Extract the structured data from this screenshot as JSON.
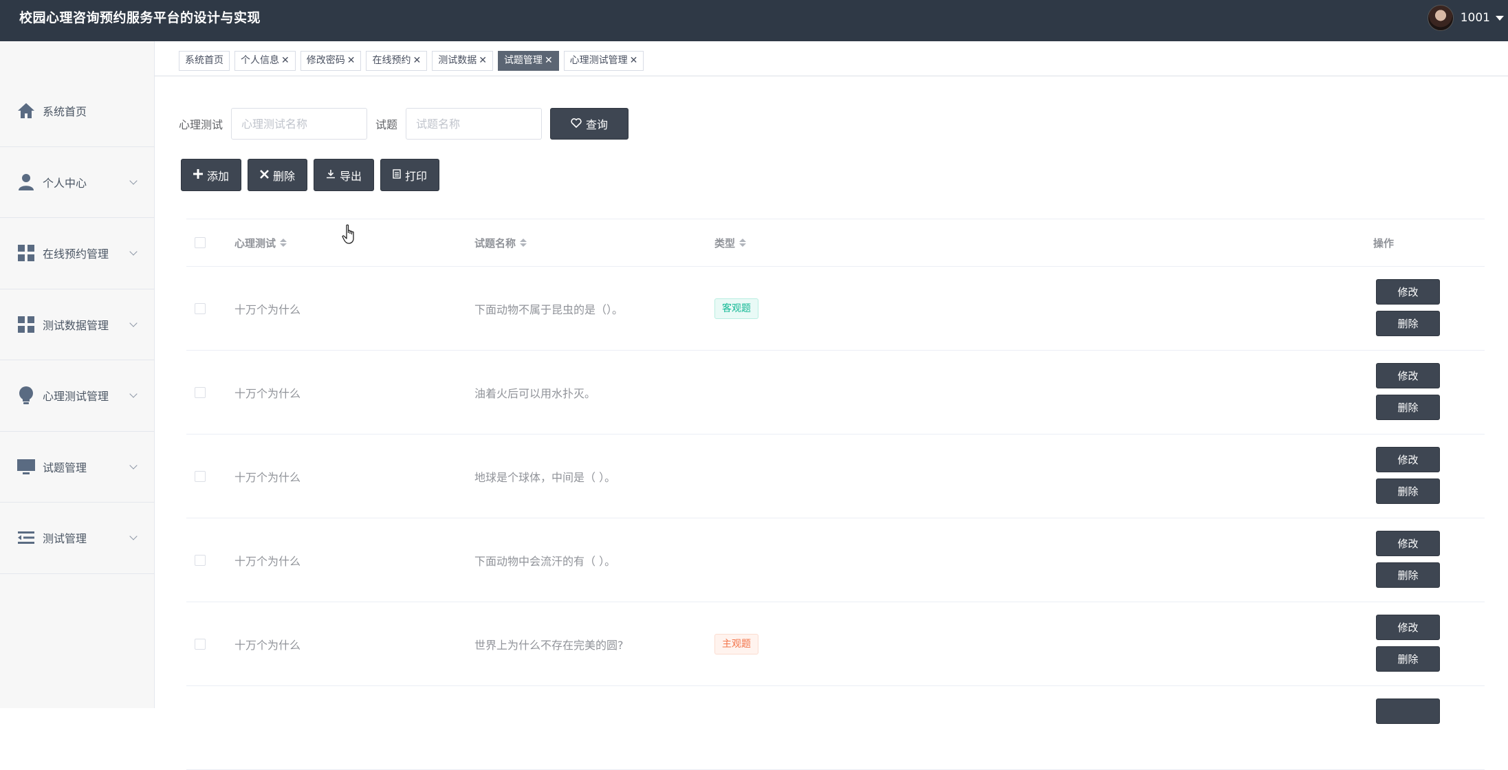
{
  "header": {
    "title": "校园心理咨询预约服务平台的设计与实现",
    "username": "1001"
  },
  "sidebar": {
    "items": [
      {
        "label": "系统首页",
        "icon": "home-icon"
      },
      {
        "label": "个人中心",
        "icon": "user-icon"
      },
      {
        "label": "在线预约管理",
        "icon": "grid-icon"
      },
      {
        "label": "测试数据管理",
        "icon": "grid-icon"
      },
      {
        "label": "心理测试管理",
        "icon": "bulb-icon"
      },
      {
        "label": "试题管理",
        "icon": "monitor-icon"
      },
      {
        "label": "测试管理",
        "icon": "list-icon"
      }
    ]
  },
  "tabs": [
    {
      "label": "系统首页",
      "closable": false,
      "active": false
    },
    {
      "label": "个人信息",
      "closable": true,
      "active": false
    },
    {
      "label": "修改密码",
      "closable": true,
      "active": false
    },
    {
      "label": "在线预约",
      "closable": true,
      "active": false
    },
    {
      "label": "测试数据",
      "closable": true,
      "active": false
    },
    {
      "label": "试题管理",
      "closable": true,
      "active": true
    },
    {
      "label": "心理测试管理",
      "closable": true,
      "active": false
    }
  ],
  "search": {
    "test_label": "心理测试",
    "test_placeholder": "心理测试名称",
    "question_label": "试题",
    "question_placeholder": "试题名称",
    "query_label": "查询"
  },
  "actions": {
    "add": "添加",
    "delete": "删除",
    "export": "导出",
    "print": "打印"
  },
  "table": {
    "columns": {
      "test": "心理测试",
      "name": "试题名称",
      "type": "类型",
      "op": "操作"
    },
    "rows": [
      {
        "test": "十万个为什么",
        "name": "下面动物不属于昆虫的是（）。",
        "type": "客观题",
        "type_kind": "obj"
      },
      {
        "test": "十万个为什么",
        "name": "油着火后可以用水扑灭。",
        "type": "",
        "type_kind": ""
      },
      {
        "test": "十万个为什么",
        "name": "地球是个球体，中间是（ ）。",
        "type": "",
        "type_kind": ""
      },
      {
        "test": "十万个为什么",
        "name": "下面动物中会流汗的有（ ）。",
        "type": "",
        "type_kind": ""
      },
      {
        "test": "十万个为什么",
        "name": "世界上为什么不存在完美的圆?",
        "type": "主观题",
        "type_kind": "sub"
      }
    ],
    "edit_label": "修改",
    "delete_label": "删除"
  },
  "colors": {
    "header_bg": "#2f3946",
    "button_bg": "#3e4652",
    "objective": "#13b895",
    "subjective": "#f2744a"
  }
}
